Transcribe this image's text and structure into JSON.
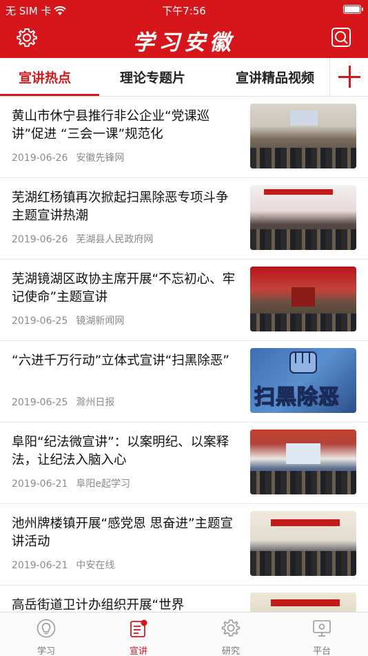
{
  "status_bar": {
    "carrier": "无 SIM 卡",
    "time": "下午7:56"
  },
  "header": {
    "title": "学习安徽",
    "left_icon": "gear-icon",
    "right_icon": "search-icon"
  },
  "tabs": [
    {
      "label": "宣讲热点",
      "active": true
    },
    {
      "label": "理论专题片",
      "active": false
    },
    {
      "label": "宣讲精品视频",
      "active": false
    }
  ],
  "articles": [
    {
      "title": "黄山市休宁县推行非公企业“党课巡讲”促进 “三会一课”规范化",
      "date": "2019-06-26",
      "source": "安徽先锋网"
    },
    {
      "title": "芜湖红杨镇再次掀起扫黑除恶专项斗争主题宣讲热潮",
      "date": "2019-06-26",
      "source": "芜湖县人民政府网"
    },
    {
      "title": "芜湖镜湖区政协主席开展“不忘初心、牢记使命”主题宣讲",
      "date": "2019-06-25",
      "source": "镜湖新闻网"
    },
    {
      "title": "“六进千万行动”立体式宣讲“扫黑除恶”",
      "date": "2019-06-25",
      "source": "滁州日报",
      "thumb_text": "扫黑除恶"
    },
    {
      "title": "阜阳“纪法微宣讲”：以案明纪、以案释法，让纪法入脑入心",
      "date": "2019-06-21",
      "source": "阜阳e起学习"
    },
    {
      "title": "池州牌楼镇开展“感党恩 思奋进”主题宣讲活动",
      "date": "2019-06-21",
      "source": "中安在线"
    },
    {
      "title": "高岳街道卫计办组织开展“世界",
      "date": "",
      "source": ""
    }
  ],
  "tab_bar": [
    {
      "label": "学习",
      "icon": "lightbulb-icon",
      "active": false
    },
    {
      "label": "宣讲",
      "icon": "lecture-icon",
      "active": true
    },
    {
      "label": "研究",
      "icon": "gear-icon",
      "active": false
    },
    {
      "label": "平台",
      "icon": "monitor-icon",
      "active": false
    }
  ],
  "colors": {
    "brand_red": "#d7161c",
    "meta_gray": "#8a8a8a"
  }
}
